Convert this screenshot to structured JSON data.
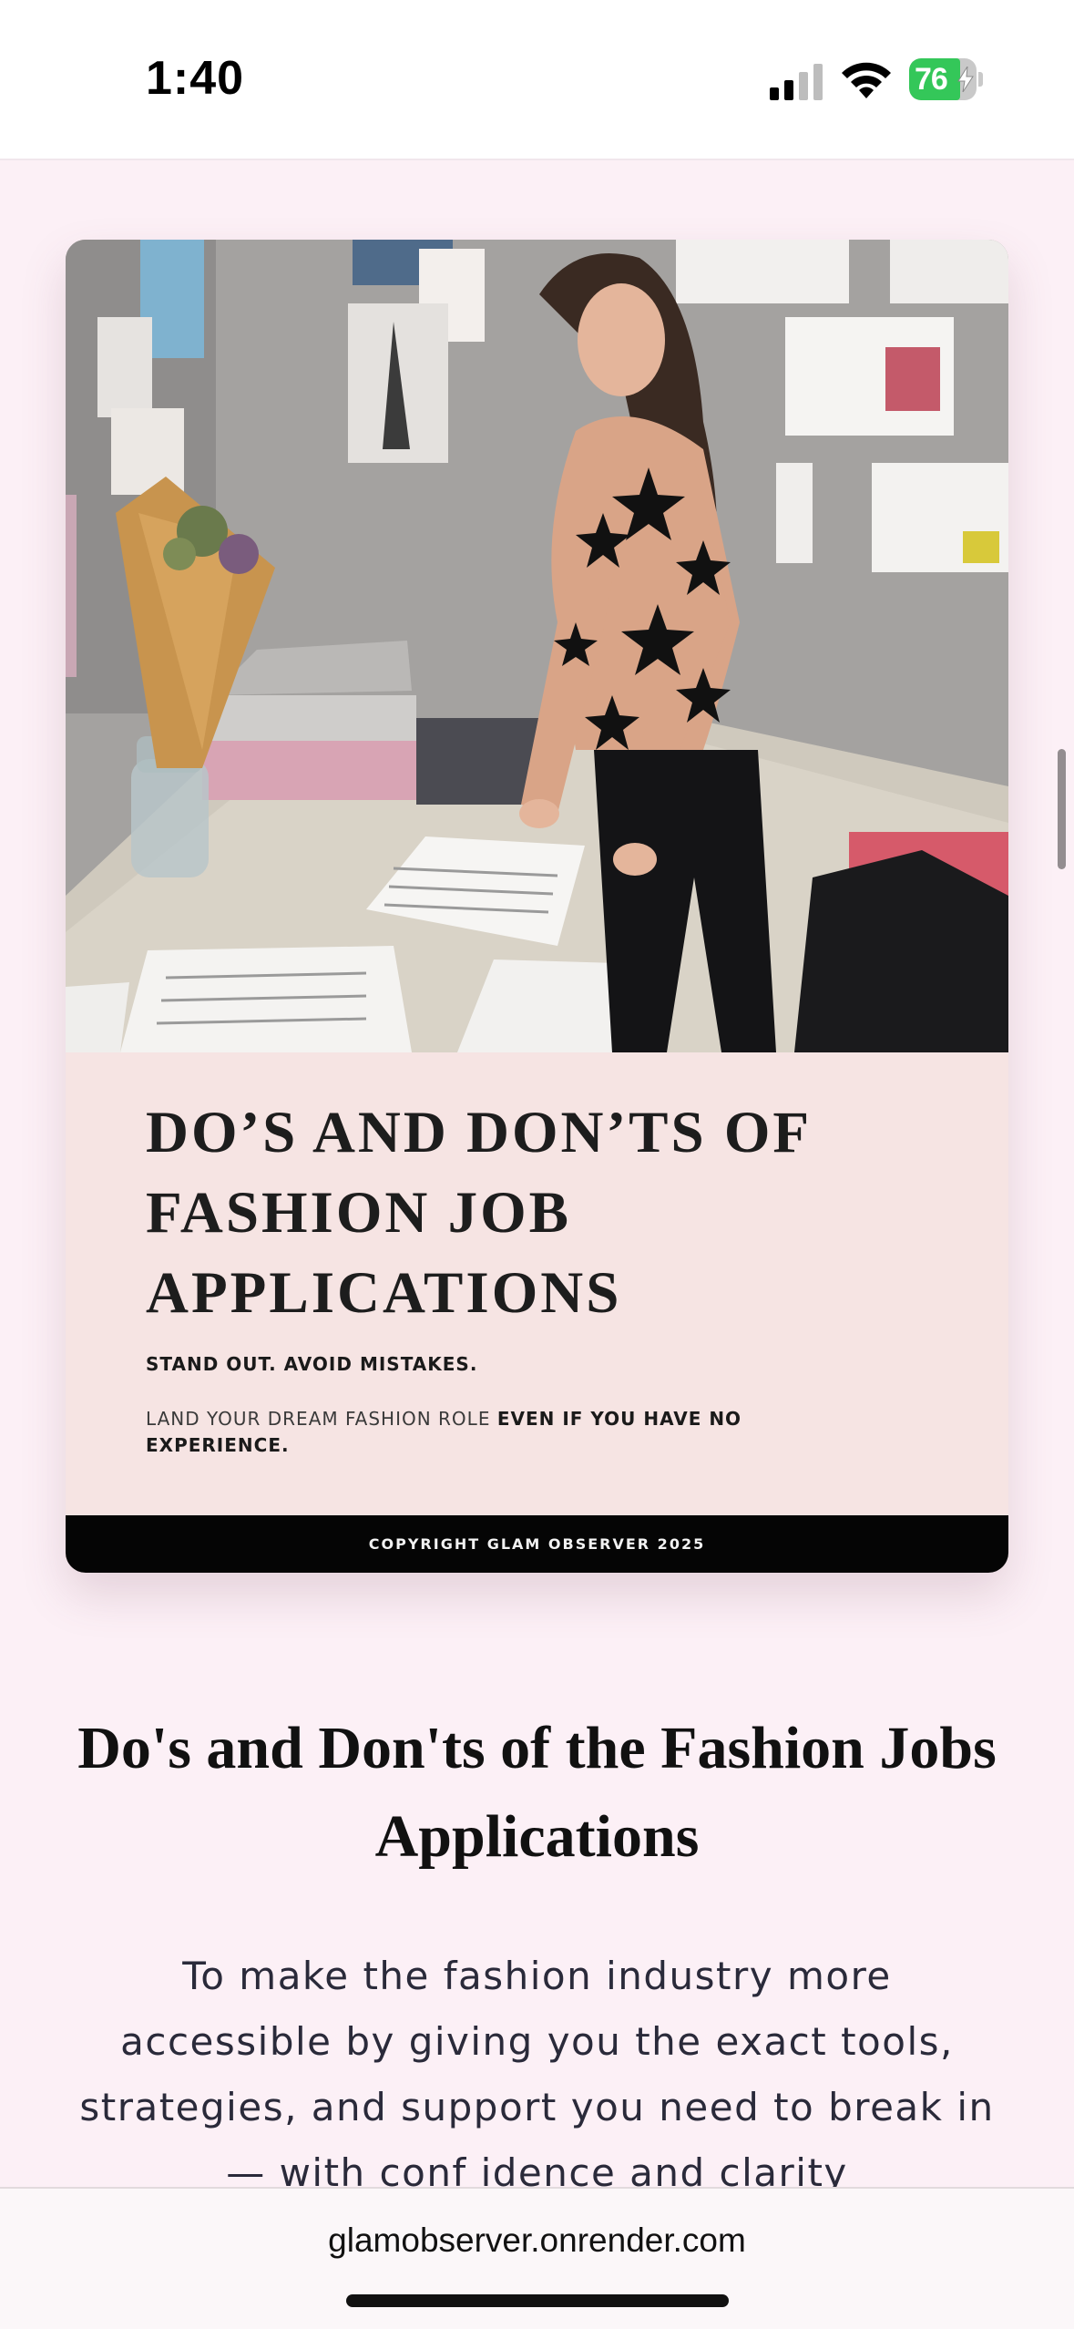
{
  "status_bar": {
    "time": "1:40",
    "battery_level": "76",
    "battery_fraction": 0.76,
    "battery_color": "#34c759",
    "icons": [
      "cellular-signal-icon",
      "wifi-icon",
      "battery-charging-icon"
    ]
  },
  "cover": {
    "photo_alt": "Woman in a star-print top reading papers at a desk",
    "heading_line_1": "DO’S AND DON’TS OF",
    "heading_line_2": "FASHION JOB",
    "heading_line_3": "APPLICATIONS",
    "tagline": "STAND OUT. AVOID MISTAKES.",
    "subline_regular": "LAND YOUR DREAM FASHION ROLE ",
    "subline_bold": "EVEN IF YOU HAVE NO EXPERIENCE.",
    "copyright": "COPYRIGHT GLAM OBSERVER 2025",
    "background_color": "#f6e4e3"
  },
  "article": {
    "title": "Do's and Don'ts of the Fashion Jobs Applications",
    "description": "To make the fashion industry more accessible by giving you the exact tools, strategies, and support you need to break in — with conf idence and clarity"
  },
  "browser": {
    "url": "glamobserver.onrender.com"
  },
  "colors": {
    "page_background": "#fcf0f6",
    "footer_band": "#050505"
  }
}
